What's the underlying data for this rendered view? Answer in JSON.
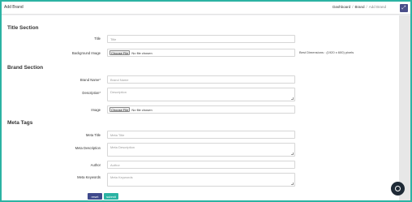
{
  "header": {
    "title": "Add Brand",
    "breadcrumb": [
      "Dashboard",
      "Brand",
      "Add Brand"
    ],
    "expand_icon": "expand-icon"
  },
  "title_section": {
    "heading": "Title Section",
    "title": {
      "label": "Title",
      "placeholder": "Title",
      "value": ""
    },
    "background_image": {
      "label": "Background Image",
      "button": "Choose File",
      "status": "No file chosen",
      "hint": "Best Dimensions : (1920 x 600) pixels"
    }
  },
  "brand_section": {
    "heading": "Brand Section",
    "brand_name": {
      "label": "Brand Name*",
      "placeholder": "Brand Name",
      "value": ""
    },
    "description": {
      "label": "Description*",
      "placeholder": "Description",
      "value": ""
    },
    "image": {
      "label": "Image",
      "button": "Choose File",
      "status": "No file chosen"
    }
  },
  "meta_tags": {
    "heading": "Meta Tags",
    "meta_title": {
      "label": "Meta Title",
      "placeholder": "Meta Title",
      "value": ""
    },
    "meta_description": {
      "label": "Meta Description",
      "placeholder": "Meta Description",
      "value": ""
    },
    "author": {
      "label": "Author",
      "placeholder": "Author",
      "value": ""
    },
    "meta_keywords": {
      "label": "Meta Keywords",
      "placeholder": "Meta Keywords",
      "value": ""
    }
  },
  "actions": {
    "reset": "reset",
    "submit": "submit"
  },
  "colors": {
    "accent": "#2bb3a3",
    "primary": "#3f4a8c",
    "chat": "#1f2a36"
  }
}
